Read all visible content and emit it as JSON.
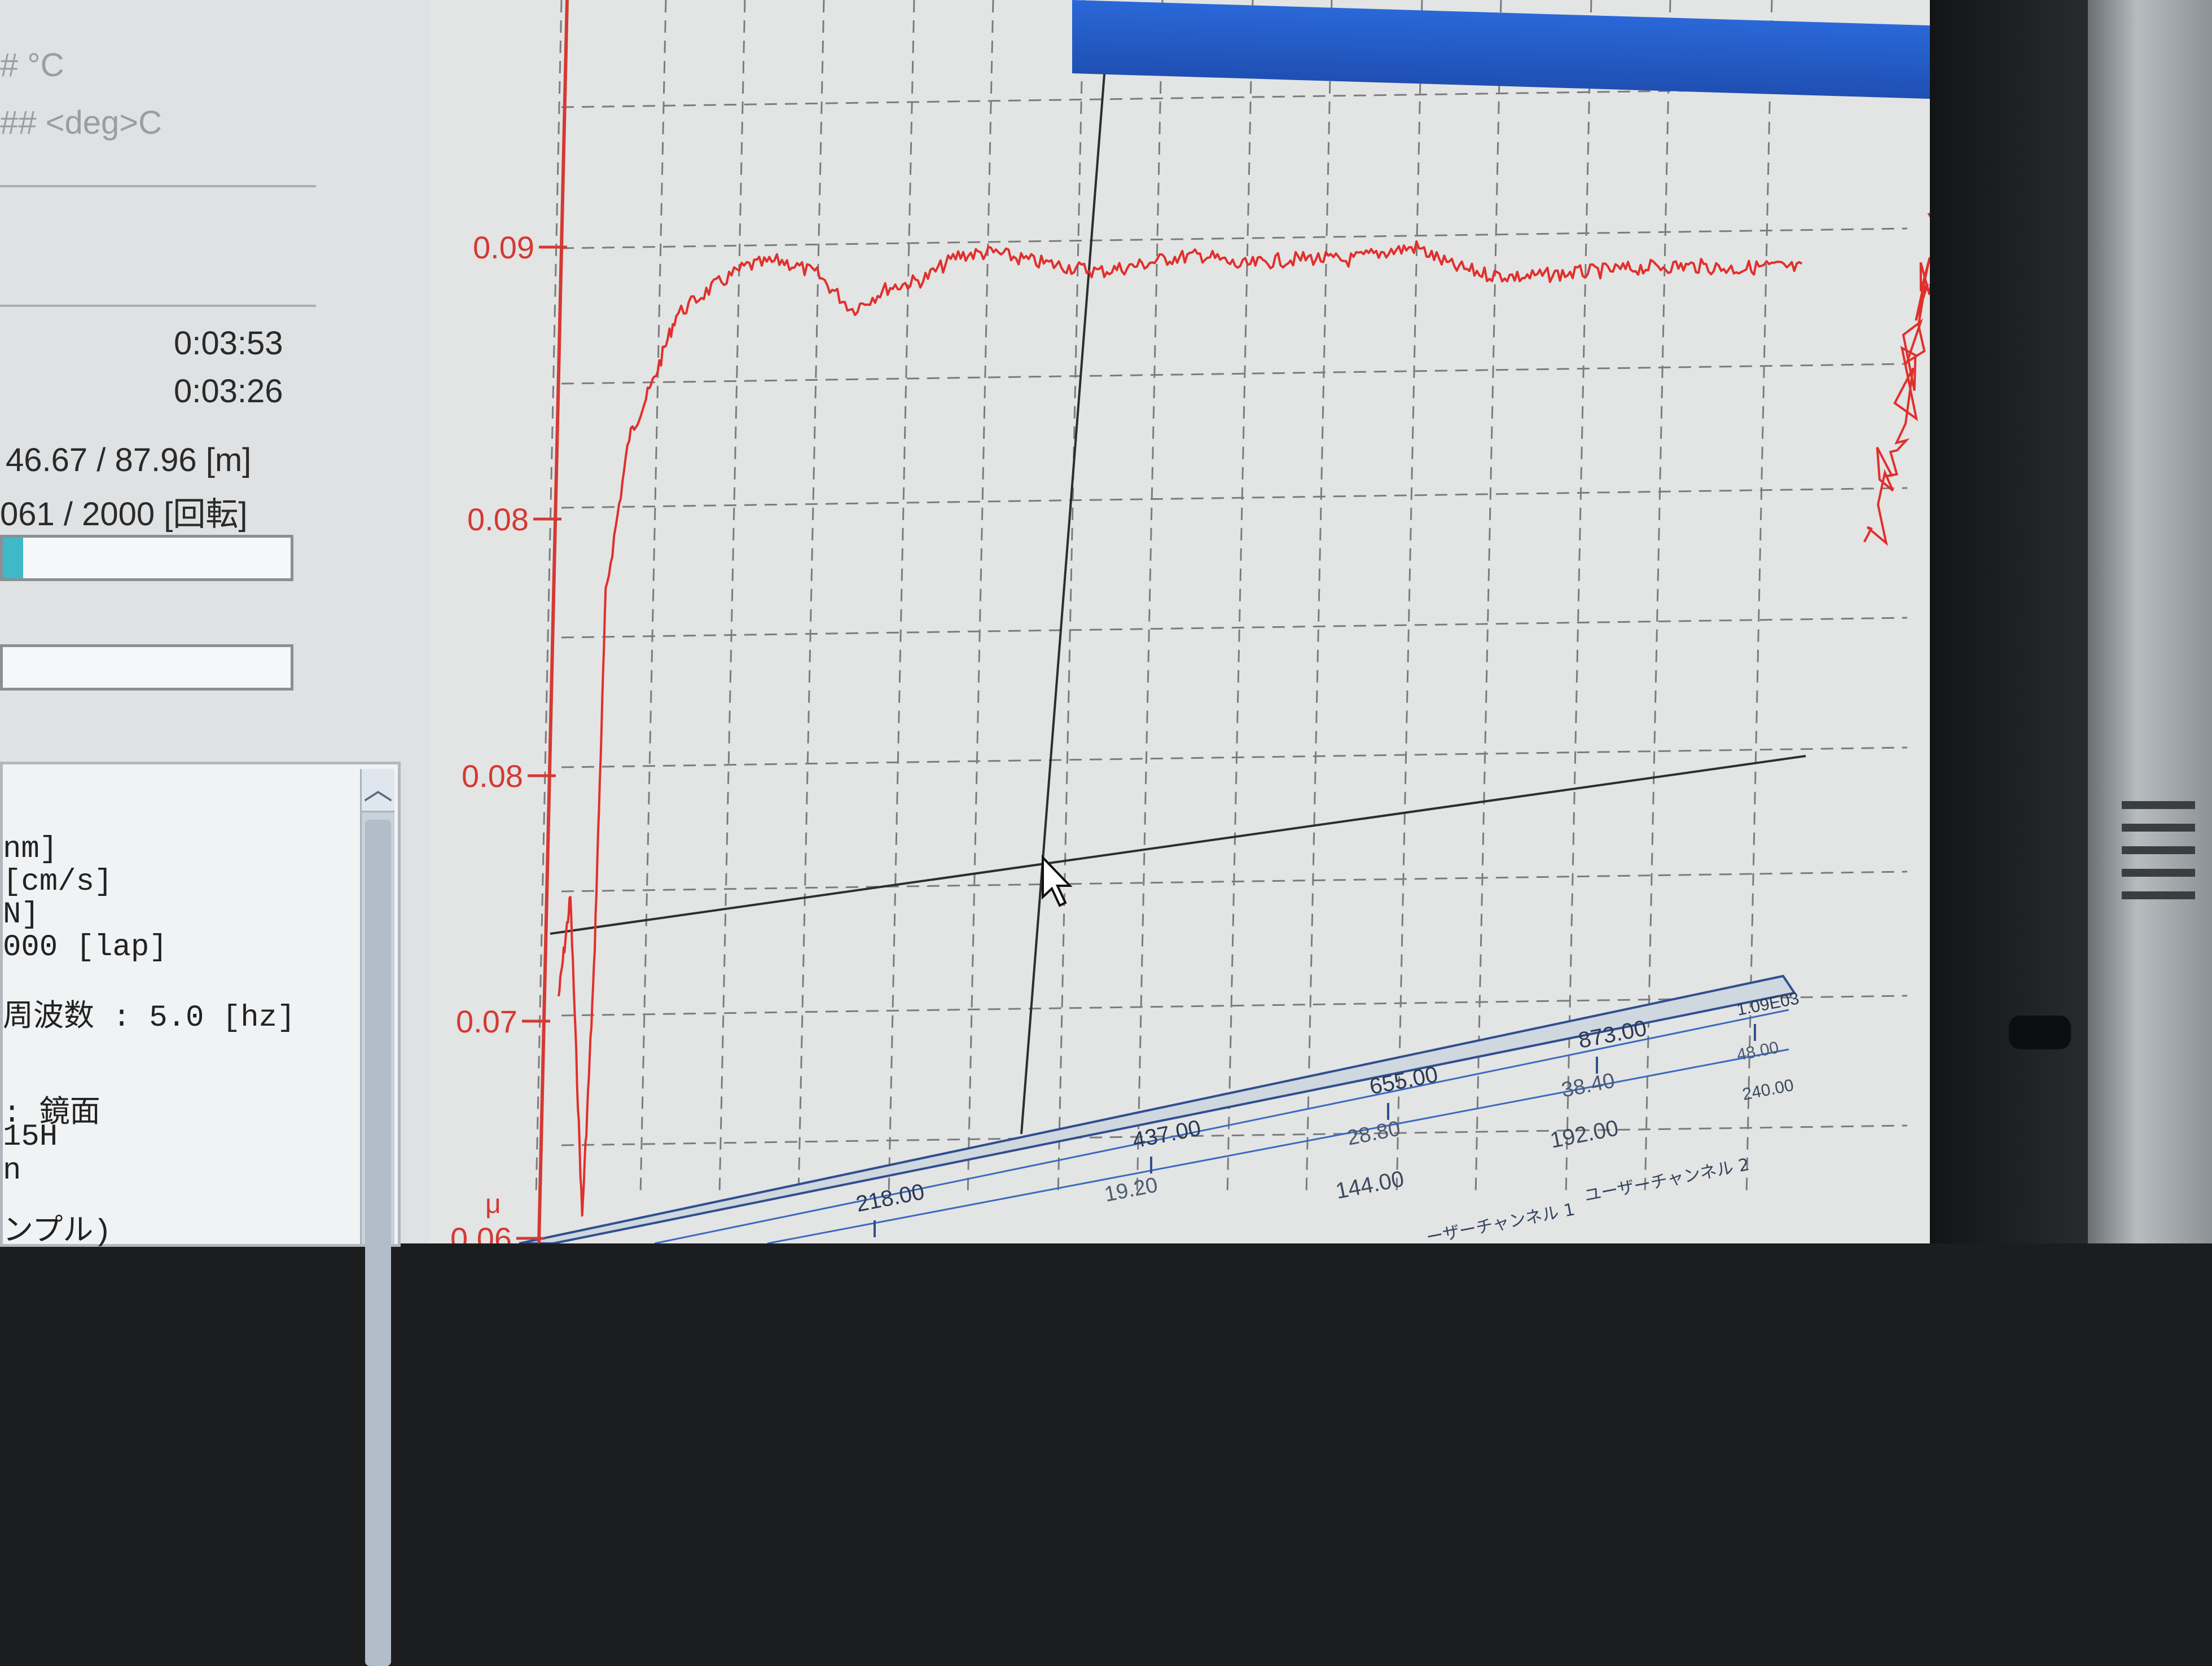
{
  "left_panel": {
    "temp_label_1": "# °C",
    "temp_label_2": "## <deg>C",
    "elapsed_time": "0:03:53",
    "remaining_time": "0:03:26",
    "distance": "46.67 / 87.96 [m]",
    "rotations": "061 / 2000 [回転]",
    "progress_1": 0.07,
    "progress_2": 0.0,
    "config_lines": [
      "nm]",
      "[cm/s]",
      "N]",
      "000 [lap]",
      "周波数 : 5.0 [hz]",
      ": 鏡面",
      "15H",
      "n",
      "ンプル)"
    ]
  },
  "plot": {
    "y_ticks": [
      "0.09",
      "0.08",
      "0.08",
      "0.07",
      "0.06"
    ],
    "y_unit": "μ",
    "x_axis_1": [
      "218.00",
      "437.00",
      "655.00",
      "873.00",
      "1.09E03"
    ],
    "x_axis_2": [
      "19.20",
      "28.80",
      "38.40",
      "48.00"
    ],
    "x_axis_3": [
      "144.00",
      "192.00",
      "240.00"
    ],
    "legend_items": [
      "ーザーチャンネル 1",
      "ユーザーチャンネル 2"
    ],
    "trace_color": "#e0302c",
    "grid_color": "#7a7c7e",
    "axis_color": "#d33a33",
    "cursor": "arrow-cursor-icon"
  },
  "chart_data": {
    "type": "line",
    "title": "",
    "xlabel": "",
    "ylabel": "μ",
    "xlim": [
      0,
      1090
    ],
    "ylim": [
      0.06,
      0.095
    ],
    "series": [
      {
        "x": [
          0,
          10,
          20,
          30,
          40,
          60,
          80,
          100,
          130,
          160,
          190,
          220,
          250,
          280,
          310,
          340,
          370,
          400,
          430,
          460,
          490,
          520,
          550,
          580,
          610,
          640,
          670,
          700,
          730,
          760,
          790,
          820,
          850,
          880,
          910,
          940,
          970,
          1000,
          1030,
          1060
        ],
        "y": [
          0.071,
          0.075,
          0.061,
          0.072,
          0.079,
          0.083,
          0.085,
          0.0875,
          0.0885,
          0.0893,
          0.0895,
          0.089,
          0.0877,
          0.0885,
          0.0888,
          0.0897,
          0.0898,
          0.0895,
          0.0893,
          0.0891,
          0.0893,
          0.0896,
          0.0897,
          0.0893,
          0.0895,
          0.0896,
          0.0895,
          0.0898,
          0.09,
          0.0893,
          0.089,
          0.0889,
          0.089,
          0.0891,
          0.0892,
          0.0893,
          0.0893,
          0.0892,
          0.0893,
          0.0892
        ]
      }
    ]
  }
}
